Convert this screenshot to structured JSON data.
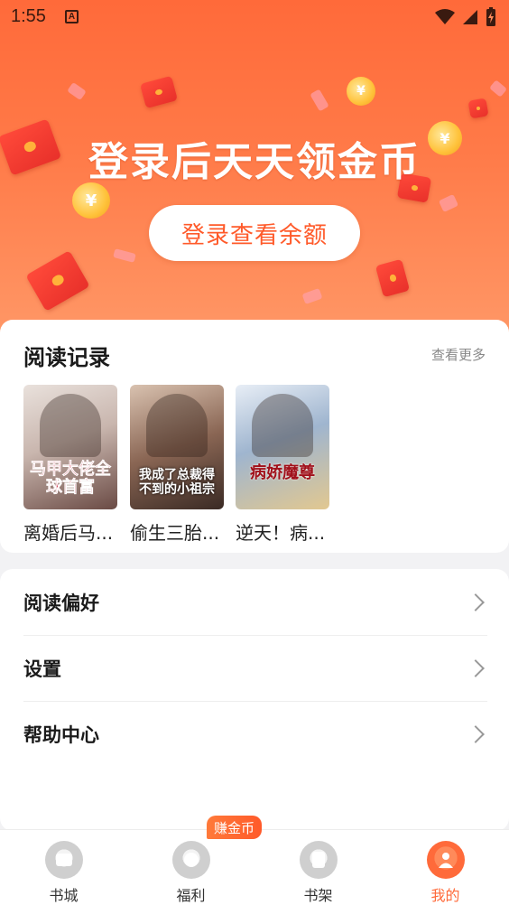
{
  "status_bar": {
    "time": "1:55",
    "notification_badge": "A"
  },
  "banner": {
    "title": "登录后天天领金币",
    "login_button": "登录查看余额",
    "coin_symbol": "¥"
  },
  "reading_record": {
    "title": "阅读记录",
    "more": "查看更多",
    "books": [
      {
        "title": "离婚后马...",
        "cover_text": "马甲大佬全球首富"
      },
      {
        "title": "偷生三胎...",
        "cover_text": "我成了总裁得不到的小祖宗"
      },
      {
        "title": "逆天！病...",
        "cover_text": "病娇魔尊"
      }
    ]
  },
  "menu": {
    "items": [
      {
        "label": "阅读偏好"
      },
      {
        "label": "设置"
      },
      {
        "label": "帮助中心"
      }
    ]
  },
  "bottom_nav": {
    "earn_badge": "赚金币",
    "items": [
      {
        "label": "书城",
        "icon": "bookstore-icon",
        "active": false
      },
      {
        "label": "福利",
        "icon": "welfare-icon",
        "active": false
      },
      {
        "label": "书架",
        "icon": "bookshelf-icon",
        "active": false
      },
      {
        "label": "我的",
        "icon": "profile-icon",
        "active": true
      }
    ]
  },
  "colors": {
    "accent": "#ff6a3a",
    "banner_top": "#ff6a3a",
    "banner_bottom": "#ff9766"
  }
}
